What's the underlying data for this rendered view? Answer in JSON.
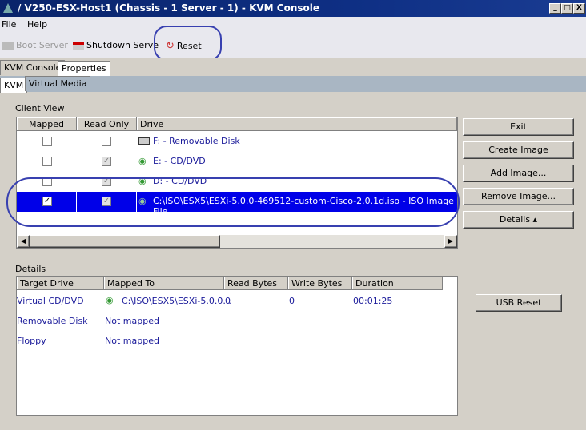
{
  "window": {
    "title": "/ V250-ESX-Host1 (Chassis - 1 Server - 1) - KVM Console",
    "controls": [
      "_",
      "□",
      "X"
    ]
  },
  "menu": [
    "File",
    "Help"
  ],
  "toolbar": {
    "boot": "Boot Server",
    "shutdown": "Shutdown Serve",
    "reset": "Reset"
  },
  "tabs": [
    "KVM Console",
    "Properties"
  ],
  "subtabs": [
    "KVM",
    "Virtual Media"
  ],
  "client_view": {
    "label": "Client View",
    "columns": [
      "Mapped",
      "Read Only",
      "Drive"
    ],
    "rows": [
      {
        "mapped": false,
        "read_only": false,
        "drive": "F: - Removable Disk"
      },
      {
        "mapped": false,
        "read_only": true,
        "drive": "E: - CD/DVD"
      },
      {
        "mapped": false,
        "read_only": true,
        "drive": "D: - CD/DVD"
      },
      {
        "mapped": true,
        "read_only": true,
        "drive": "C:\\ISO\\ESX5\\ESXi-5.0.0-469512-custom-Cisco-2.0.1d.iso - ISO Image File"
      }
    ]
  },
  "buttons": {
    "exit": "Exit",
    "create": "Create Image",
    "add": "Add Image...",
    "remove": "Remove Image...",
    "details": "Details ▴",
    "usb_reset": "USB Reset"
  },
  "details": {
    "label": "Details",
    "columns": [
      "Target Drive",
      "Mapped To",
      "Read Bytes",
      "Write Bytes",
      "Duration"
    ],
    "rows": [
      {
        "target": "Virtual CD/DVD",
        "mapped": "C:\\ISO\\ESX5\\ESXi-5.0.0...",
        "read": "0",
        "write": "0",
        "duration": "00:01:25"
      },
      {
        "target": "Removable Disk",
        "mapped": "Not mapped",
        "read": "",
        "write": "",
        "duration": ""
      },
      {
        "target": "Floppy",
        "mapped": "Not mapped",
        "read": "",
        "write": "",
        "duration": ""
      }
    ]
  }
}
